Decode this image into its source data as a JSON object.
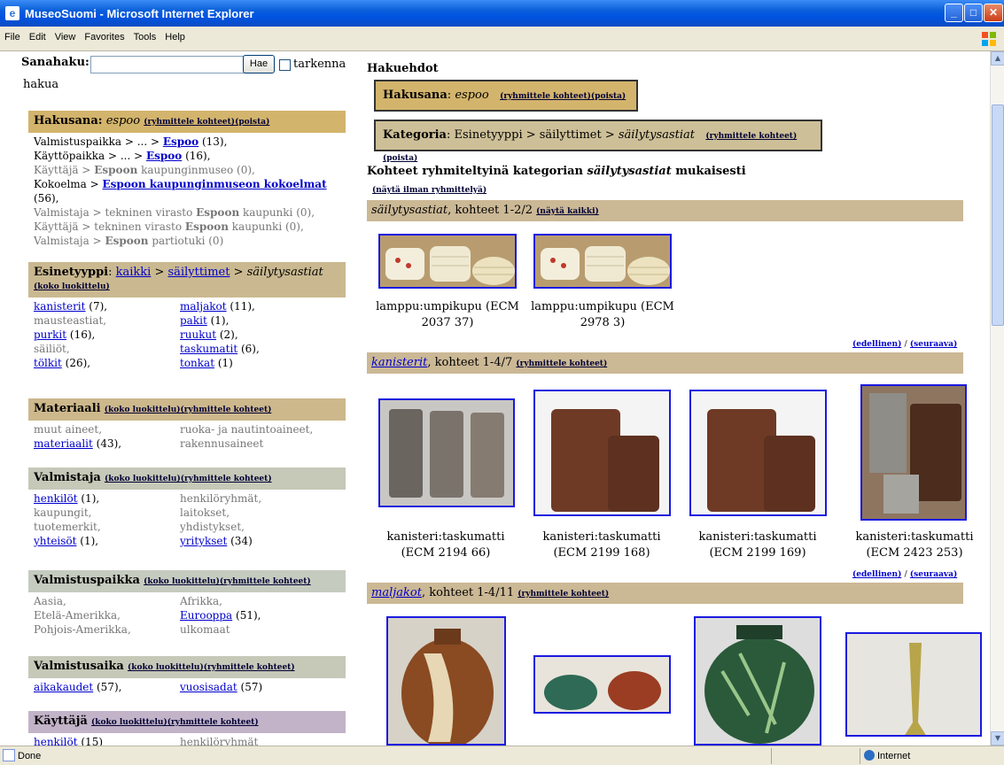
{
  "window": {
    "title": "MuseoSuomi - Microsoft Internet Explorer",
    "icon": "ie-page-icon"
  },
  "menu": [
    "File",
    "Edit",
    "View",
    "Favorites",
    "Tools",
    "Help"
  ],
  "status": {
    "text": "Done",
    "zone": "Internet"
  },
  "search": {
    "label": "Sanahaku:",
    "value": "",
    "button": "Hae",
    "refine_1": "tarkenna",
    "refine_2": "hakua"
  },
  "facets": {
    "hakusana": {
      "title": "Hakusana:",
      "term": "espoo",
      "group": "(ryhmittele kohteet)",
      "remove": "(poista)",
      "lines": [
        {
          "pre": "Valmistuspaikka > ... > ",
          "link": "Espoo",
          "post": " (13),",
          "active": true
        },
        {
          "pre": "Käyttöpaikka > ... > ",
          "link": "Espoo",
          "post": " (16),",
          "active": true
        },
        {
          "pre": "Käyttäjä > ",
          "link": "Espoon",
          "post": " kaupunginmuseo (0),",
          "active": false
        },
        {
          "pre": "Kokoelma > ",
          "link": "Espoon kaupunginmuseon kokoelmat",
          "post": " (56),",
          "active": true
        },
        {
          "pre": "Valmistaja > tekninen virasto ",
          "link": "Espoon",
          "post": " kaupunki (0),",
          "active": false
        },
        {
          "pre": "Käyttäjä > tekninen virasto ",
          "link": "Espoon",
          "post": " kaupunki (0),",
          "active": false
        },
        {
          "pre": "Valmistaja > ",
          "link": "Espoon",
          "post": " partiotuki (0)",
          "active": false
        }
      ]
    },
    "esinetyyppi": {
      "title": "Esinetyyppi",
      "crumb_all": "kaikki",
      "crumb_sep": " > ",
      "crumb_1": "säilyttimet",
      "crumb_cur": "säilytysastiat",
      "full": "(koko luokittelu)",
      "items": [
        {
          "link": "kanisterit",
          "count": " (7),"
        },
        {
          "link": "maljakot",
          "count": " (11),"
        },
        {
          "text": "mausteastiat,"
        },
        {
          "link": "pakit",
          "count": " (1),"
        },
        {
          "link": "purkit",
          "count": " (16),"
        },
        {
          "link": "ruukut",
          "count": " (2),"
        },
        {
          "text": "säiliöt,"
        },
        {
          "link": "taskumatit",
          "count": " (6),"
        },
        {
          "link": "tölkit",
          "count": " (26),"
        },
        {
          "link": "tonkat",
          "count": " (1)"
        }
      ]
    },
    "materiaali": {
      "title": "Materiaali",
      "full": "(koko luokittelu)",
      "group": "(ryhmittele kohteet)",
      "items": [
        {
          "text": "muut aineet,"
        },
        {
          "text": "ruoka- ja nautintoaineet,"
        },
        {
          "link": "materiaalit",
          "count": " (43),"
        },
        {
          "text": "rakennusaineet"
        }
      ]
    },
    "valmistaja": {
      "title": "Valmistaja",
      "full": "(koko luokittelu)",
      "group": "(ryhmittele kohteet)",
      "items": [
        {
          "link": "henkilöt",
          "count": " (1),"
        },
        {
          "text": "henkilöryhmät,"
        },
        {
          "text": "kaupungit,"
        },
        {
          "text": "laitokset,"
        },
        {
          "text": "tuotemerkit,"
        },
        {
          "text": "yhdistykset,"
        },
        {
          "link": "yhteisöt",
          "count": " (1),"
        },
        {
          "link": "yritykset",
          "count": " (34)"
        }
      ]
    },
    "valmistuspaikka": {
      "title": "Valmistuspaikka",
      "full": "(koko luokittelu)",
      "group": "(ryhmittele kohteet)",
      "items": [
        {
          "text": "Aasia,"
        },
        {
          "text": "Afrikka,"
        },
        {
          "text": "Etelä-Amerikka,"
        },
        {
          "link": "Eurooppa",
          "count": " (51),"
        },
        {
          "text": "Pohjois-Amerikka,"
        },
        {
          "text": "ulkomaat"
        }
      ]
    },
    "valmistusaika": {
      "title": "Valmistusaika",
      "full": "(koko luokittelu)",
      "group": "(ryhmittele kohteet)",
      "items": [
        {
          "link": "aikakaudet",
          "count": " (57),"
        },
        {
          "link": "vuosisadat",
          "count": " (57)"
        }
      ]
    },
    "kayttaja": {
      "title": "Käyttäjä",
      "full": "(koko luokittelu)",
      "group": "(ryhmittele kohteet)",
      "items": [
        {
          "link": "henkilöt",
          "count": " (15)"
        },
        {
          "text": "henkilöryhmät"
        }
      ]
    }
  },
  "criteria": {
    "heading": "Hakuehdot",
    "c1": {
      "label": "Hakusana",
      "sep": ": ",
      "value": "espoo",
      "group": "(ryhmittele kohteet)",
      "remove": "(poista)"
    },
    "c2": {
      "label": "Kategoria",
      "sep": ": ",
      "path": "Esinetyyppi > säilyttimet > ",
      "value": "säilytysastiat",
      "group": "(ryhmittele kohteet)",
      "remove": "(poista)"
    }
  },
  "results": {
    "heading_pre": "Kohteet ryhmiteltyinä kategorian ",
    "heading_cat": "säilytysastiat",
    "heading_post": " mukaisesti",
    "no_group": "(näytä ilman ryhmittelyä)",
    "groups": [
      {
        "name": "säilytysastiat",
        "info": ", kohteet 1-2/2 ",
        "action": "(näytä kaikki)",
        "captions": [
          "lamppu:umpikupu (ECM 2037 37)",
          "lamppu:umpikupu (ECM 2978 3)"
        ]
      },
      {
        "name": "kanisterit",
        "info": ", kohteet 1-4/7 ",
        "action": "(ryhmittele kohteet)",
        "captions": [
          "kanisteri:taskumatti (ECM 2194 66)",
          "kanisteri:taskumatti (ECM 2199 168)",
          "kanisteri:taskumatti (ECM 2199 169)",
          "kanisteri:taskumatti (ECM 2423 253)"
        ]
      },
      {
        "name": "maljakot",
        "info": ", kohteet 1-4/11 ",
        "action": "(ryhmittele kohteet)",
        "captions": []
      }
    ],
    "prev": "(edellinen)",
    "slash": " / ",
    "next": "(seuraava)"
  }
}
